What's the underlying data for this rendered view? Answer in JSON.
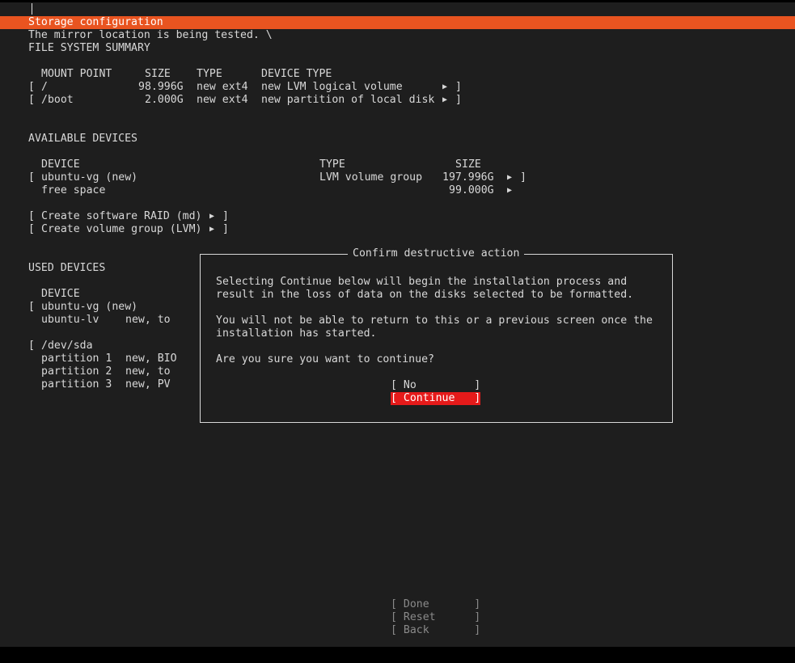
{
  "header": {
    "title": "Storage configuration",
    "status": "The mirror location is being tested. \\"
  },
  "summary": {
    "heading": "FILE SYSTEM SUMMARY",
    "columns": [
      "MOUNT POINT",
      "SIZE",
      "TYPE",
      "DEVICE TYPE"
    ],
    "rows": [
      {
        "open": "[",
        "mount": "/",
        "size": "98.996G",
        "type": "new ext4",
        "device_type": "new LVM logical volume",
        "arrow": "▶",
        "close": "]"
      },
      {
        "open": "[",
        "mount": "/boot",
        "size": "2.000G",
        "type": "new ext4",
        "device_type": "new partition of local disk",
        "arrow": "▶",
        "close": "]"
      }
    ]
  },
  "available": {
    "heading": "AVAILABLE DEVICES",
    "columns": [
      "DEVICE",
      "TYPE",
      "SIZE"
    ],
    "vg": {
      "open": "[",
      "device": "ubuntu-vg (new)",
      "type": "LVM volume group",
      "size": "197.996G",
      "arrow": "▶",
      "close": "]"
    },
    "free": {
      "device": "free space",
      "size": "99.000G",
      "arrow": "▶"
    },
    "actions": [
      {
        "open": "[",
        "label": "Create software RAID (md)",
        "arrow": "▶",
        "close": "]"
      },
      {
        "open": "[",
        "label": "Create volume group (LVM)",
        "arrow": "▶",
        "close": "]"
      }
    ]
  },
  "used": {
    "heading": "USED DEVICES",
    "column": "DEVICE",
    "vg": {
      "open": "[",
      "device": "ubuntu-vg (new)"
    },
    "lv": {
      "device": "ubuntu-lv",
      "info": "new, to"
    },
    "disk": {
      "open": "[",
      "device": "/dev/sda"
    },
    "partitions": [
      {
        "device": "partition 1",
        "info": "new, BIO"
      },
      {
        "device": "partition 2",
        "info": "new, to"
      },
      {
        "device": "partition 3",
        "info": "new, PV"
      }
    ]
  },
  "dialog": {
    "title": "Confirm destructive action",
    "lines": [
      "Selecting Continue below will begin the installation process and",
      "result in the loss of data on the disks selected to be formatted.",
      "You will not be able to return to this or a previous screen once the",
      "installation has started.",
      "Are you sure you want to continue?"
    ],
    "no_label": "[ No         ]",
    "continue_label": "[ Continue   ]"
  },
  "footer": {
    "done_label": "[ Done       ]",
    "reset_label": "[ Reset      ]",
    "back_label": "[ Back       ]"
  },
  "colors": {
    "title_bar": "#e95420",
    "continue_button": "#e51a1a",
    "background": "#1e1e1e"
  }
}
